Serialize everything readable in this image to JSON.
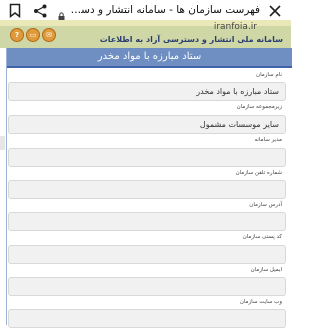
{
  "browser": {
    "title": "فهرست سازمان ها - سامانه انتشار و دسترسی آزاد به اطلا...",
    "url": "iranfoia.ir"
  },
  "header": {
    "site_name": "سامانه ملی انتشار و دسترسی آزاد به اطلاعات",
    "help_glyph": "?",
    "print_glyph": "▭",
    "mail_glyph": "✉"
  },
  "panel": {
    "title": "ستاد مبارزه با مواد مخدر"
  },
  "form": {
    "fields": [
      {
        "label": "نام سازمان",
        "value": "ستاد مبارزه با مواد مخدر"
      },
      {
        "label": "زیرمجموعه سازمان",
        "value": "سایر موسسات مشمول"
      },
      {
        "label": "مدیر سامانه",
        "value": ""
      },
      {
        "label": "شماره تلفن سازمان",
        "value": ""
      },
      {
        "label": "آدرس سازمان",
        "value": ""
      },
      {
        "label": "کد پستی سازمان",
        "value": ""
      },
      {
        "label": "ایمیل سازمان",
        "value": ""
      },
      {
        "label": "وب سایت سازمان",
        "value": ""
      }
    ]
  },
  "icons": {
    "bookmark": "bookmark-icon",
    "share": "share-icon",
    "lock": "lock-icon",
    "close": "close-icon"
  },
  "colors": {
    "panel_header": "#6f8fc3",
    "site_header": "#cfd7a7",
    "button_orange": "#e09a3c"
  }
}
